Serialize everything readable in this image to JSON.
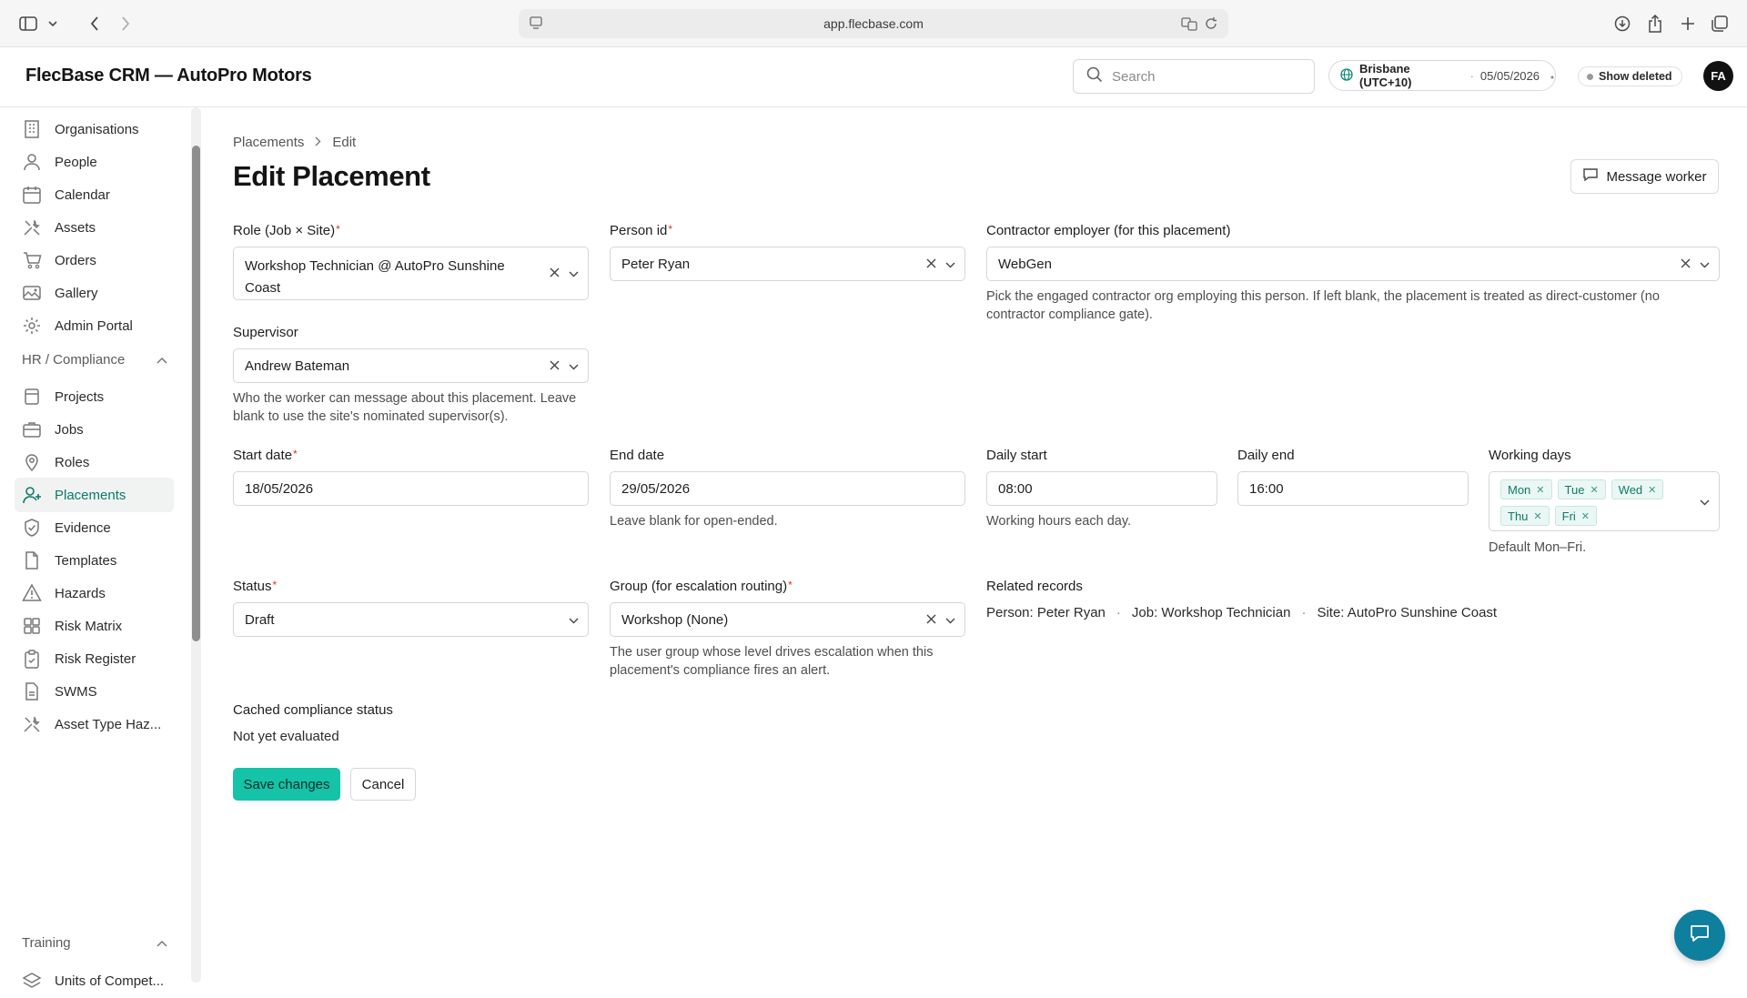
{
  "browser": {
    "url": "app.flecbase.com"
  },
  "header": {
    "app_title": "FlecBase CRM — AutoPro Motors",
    "search_placeholder": "Search",
    "timezone_name": "Brisbane (UTC+10)",
    "timezone_sep": "·",
    "timezone_date": "05/05/2026",
    "show_deleted_label": "Show deleted",
    "avatar_initials": "FA"
  },
  "sidebar": {
    "items_top": [
      {
        "label": "Organisations",
        "icon": "building-icon"
      },
      {
        "label": "People",
        "icon": "person-icon"
      },
      {
        "label": "Calendar",
        "icon": "calendar-icon"
      },
      {
        "label": "Assets",
        "icon": "tools-icon"
      },
      {
        "label": "Orders",
        "icon": "cart-icon"
      },
      {
        "label": "Gallery",
        "icon": "image-icon"
      },
      {
        "label": "Admin Portal",
        "icon": "gear-icon"
      }
    ],
    "section_hr": "HR / Compliance",
    "items_hr": [
      {
        "label": "Projects",
        "icon": "stack-icon"
      },
      {
        "label": "Jobs",
        "icon": "briefcase-icon"
      },
      {
        "label": "Roles",
        "icon": "pin-icon"
      },
      {
        "label": "Placements",
        "icon": "user-plus-icon",
        "active": true
      },
      {
        "label": "Evidence",
        "icon": "shield-check-icon"
      },
      {
        "label": "Templates",
        "icon": "document-icon"
      },
      {
        "label": "Hazards",
        "icon": "warning-icon"
      },
      {
        "label": "Risk Matrix",
        "icon": "grid-icon"
      },
      {
        "label": "Risk Register",
        "icon": "clipboard-icon"
      },
      {
        "label": "SWMS",
        "icon": "file-icon"
      },
      {
        "label": "Asset Type Haz...",
        "icon": "tools-icon"
      }
    ],
    "section_training": "Training",
    "items_training": [
      {
        "label": "Units of Compet...",
        "icon": "layers-icon"
      }
    ]
  },
  "main": {
    "breadcrumb": [
      "Placements",
      "Edit"
    ],
    "title": "Edit Placement",
    "message_worker": "Message worker",
    "fields": {
      "role": {
        "label": "Role (Job × Site)",
        "value_line1": "Workshop Technician @ AutoPro Sunshine",
        "value_line2": "Coast"
      },
      "person": {
        "label": "Person id",
        "value": "Peter Ryan"
      },
      "contractor": {
        "label": "Contractor employer (for this placement)",
        "value": "WebGen",
        "help": "Pick the engaged contractor org employing this person. If left blank, the placement is treated as direct-customer (no contractor compliance gate)."
      },
      "supervisor": {
        "label": "Supervisor",
        "value": "Andrew Bateman",
        "help": "Who the worker can message about this placement. Leave blank to use the site's nominated supervisor(s)."
      },
      "start_date": {
        "label": "Start date",
        "value": "18/05/2026"
      },
      "end_date": {
        "label": "End date",
        "value": "29/05/2026",
        "help": "Leave blank for open-ended."
      },
      "daily_start": {
        "label": "Daily start",
        "value": "08:00",
        "help": "Working hours each day."
      },
      "daily_end": {
        "label": "Daily end",
        "value": "16:00"
      },
      "working_days": {
        "label": "Working days",
        "chips": [
          "Mon",
          "Tue",
          "Wed",
          "Thu",
          "Fri"
        ],
        "help": "Default Mon–Fri."
      },
      "status": {
        "label": "Status",
        "value": "Draft"
      },
      "group": {
        "label": "Group (for escalation routing)",
        "value": "Workshop (None)",
        "help": "The user group whose level drives escalation when this placement's compliance fires an alert."
      },
      "related": {
        "label": "Related records",
        "person": "Person: Peter Ryan",
        "job": "Job: Workshop Technician",
        "site": "Site: AutoPro Sunshine Coast",
        "sep": "·"
      },
      "cached": {
        "label": "Cached compliance status",
        "value": "Not yet evaluated"
      }
    },
    "save_label": "Save changes",
    "cancel_label": "Cancel"
  }
}
